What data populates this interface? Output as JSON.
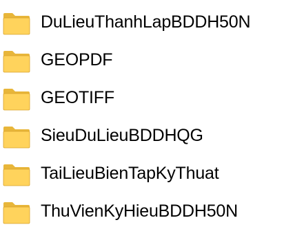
{
  "folders": [
    {
      "name": "DuLieuThanhLapBDDH50N",
      "icon": "folder-icon"
    },
    {
      "name": "GEOPDF",
      "icon": "folder-icon"
    },
    {
      "name": "GEOTIFF",
      "icon": "folder-icon"
    },
    {
      "name": "SieuDuLieuBDDHQG",
      "icon": "folder-icon"
    },
    {
      "name": "TaiLieuBienTapKyThuat",
      "icon": "folder-icon"
    },
    {
      "name": "ThuVienKyHieuBDDH50N",
      "icon": "folder-icon"
    }
  ],
  "colors": {
    "folder_back": "#e8b63a",
    "folder_front": "#ffd35c",
    "folder_edge": "#d9a22a",
    "text": "#000000"
  }
}
